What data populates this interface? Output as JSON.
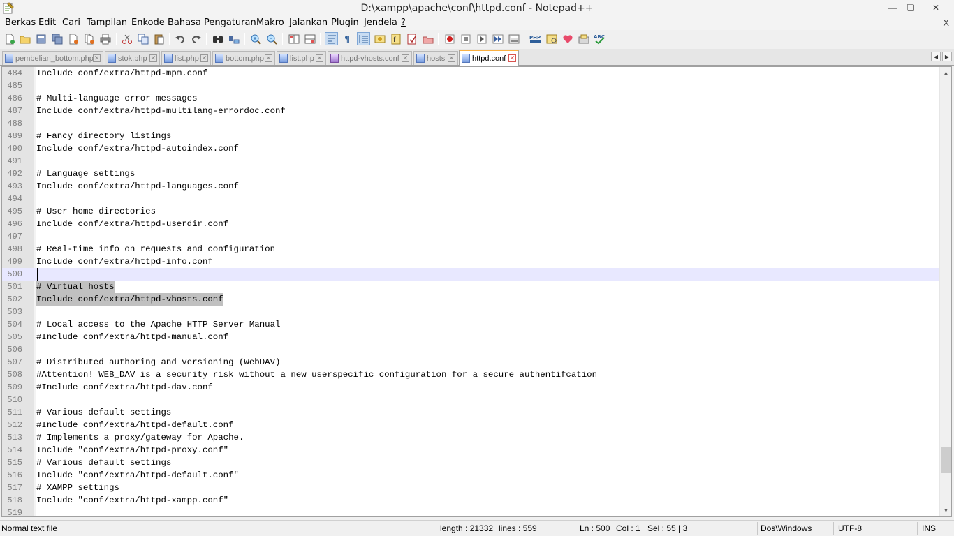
{
  "window": {
    "title": "D:\\xampp\\apache\\conf\\httpd.conf - Notepad++",
    "minimize_glyph": "—",
    "maximize_glyph": "❏",
    "close_glyph": "✕"
  },
  "menu": {
    "items": [
      "Berkas",
      "Edit",
      "Cari",
      "Tampilan",
      "Enkode",
      "Bahasa",
      "Pengaturan",
      "Makro",
      "Jalankan",
      "Plugin",
      "Jendela",
      "?"
    ],
    "close_label": "X"
  },
  "toolbar": {
    "icons": [
      "new-file-icon",
      "open-file-icon",
      "save-icon",
      "save-all-icon",
      "close-icon",
      "close-all-icon",
      "print-icon",
      "cut-icon",
      "copy-icon",
      "paste-icon",
      "undo-icon",
      "redo-icon",
      "find-icon",
      "replace-icon",
      "zoom-in-icon",
      "zoom-out-icon",
      "sync-vertical-icon",
      "sync-horizontal-icon",
      "word-wrap-icon",
      "show-all-chars-icon",
      "indent-guide-icon",
      "doc-map-icon",
      "function-list-icon",
      "folder-workspace-icon",
      "monitoring-icon",
      "record-macro-icon",
      "stop-record-icon",
      "play-macro-icon",
      "run-macro-multiple-icon",
      "save-macro-icon",
      "php-icon",
      "plugin-manager-icon",
      "heart-icon",
      "npp-export-icon",
      "spell-check-icon"
    ],
    "active": [
      "word-wrap-icon",
      "indent-guide-icon"
    ]
  },
  "tabs": [
    {
      "label": "pembelian_bottom.php",
      "active": false,
      "icon": "blue"
    },
    {
      "label": "stok.php",
      "active": false,
      "icon": "blue"
    },
    {
      "label": "list.php",
      "active": false,
      "icon": "blue"
    },
    {
      "label": "bottom.php",
      "active": false,
      "icon": "blue"
    },
    {
      "label": "list.php",
      "active": false,
      "icon": "blue"
    },
    {
      "label": "httpd-vhosts.conf",
      "active": false,
      "icon": "purple"
    },
    {
      "label": "hosts",
      "active": false,
      "icon": "blue"
    },
    {
      "label": "httpd.conf",
      "active": true,
      "icon": "blue"
    }
  ],
  "tab_close_glyph": "✕",
  "tab_nav": {
    "left": "◀",
    "right": "▶"
  },
  "editor": {
    "current_line": 500,
    "selected_lines": [
      501,
      502
    ],
    "lines": [
      {
        "n": "484",
        "text": "Include conf/extra/httpd-mpm.conf"
      },
      {
        "n": "485",
        "text": ""
      },
      {
        "n": "486",
        "text": "# Multi-language error messages"
      },
      {
        "n": "487",
        "text": "Include conf/extra/httpd-multilang-errordoc.conf"
      },
      {
        "n": "488",
        "text": ""
      },
      {
        "n": "489",
        "text": "# Fancy directory listings"
      },
      {
        "n": "490",
        "text": "Include conf/extra/httpd-autoindex.conf"
      },
      {
        "n": "491",
        "text": ""
      },
      {
        "n": "492",
        "text": "# Language settings"
      },
      {
        "n": "493",
        "text": "Include conf/extra/httpd-languages.conf"
      },
      {
        "n": "494",
        "text": ""
      },
      {
        "n": "495",
        "text": "# User home directories"
      },
      {
        "n": "496",
        "text": "Include conf/extra/httpd-userdir.conf"
      },
      {
        "n": "497",
        "text": ""
      },
      {
        "n": "498",
        "text": "# Real-time info on requests and configuration"
      },
      {
        "n": "499",
        "text": "Include conf/extra/httpd-info.conf"
      },
      {
        "n": "500",
        "text": ""
      },
      {
        "n": "501",
        "text": "# Virtual hosts"
      },
      {
        "n": "502",
        "text": "Include conf/extra/httpd-vhosts.conf"
      },
      {
        "n": "503",
        "text": ""
      },
      {
        "n": "504",
        "text": "# Local access to the Apache HTTP Server Manual"
      },
      {
        "n": "505",
        "text": "#Include conf/extra/httpd-manual.conf"
      },
      {
        "n": "506",
        "text": ""
      },
      {
        "n": "507",
        "text": "# Distributed authoring and versioning (WebDAV)"
      },
      {
        "n": "508",
        "text": "#Attention! WEB_DAV is a security risk without a new userspecific configuration for a secure authentifcation"
      },
      {
        "n": "509",
        "text": "#Include conf/extra/httpd-dav.conf"
      },
      {
        "n": "510",
        "text": ""
      },
      {
        "n": "511",
        "text": "# Various default settings"
      },
      {
        "n": "512",
        "text": "#Include conf/extra/httpd-default.conf"
      },
      {
        "n": "513",
        "text": "# Implements a proxy/gateway for Apache."
      },
      {
        "n": "514",
        "text": "Include \"conf/extra/httpd-proxy.conf\""
      },
      {
        "n": "515",
        "text": "# Various default settings"
      },
      {
        "n": "516",
        "text": "Include \"conf/extra/httpd-default.conf\""
      },
      {
        "n": "517",
        "text": "# XAMPP settings"
      },
      {
        "n": "518",
        "text": "Include \"conf/extra/httpd-xampp.conf\""
      },
      {
        "n": "519",
        "text": ""
      }
    ]
  },
  "scrollbar": {
    "up": "▲",
    "down": "▼",
    "position_fraction": 0.86
  },
  "status": {
    "file_type": "Normal text file",
    "length": "length : 21332",
    "lines": "lines : 559",
    "ln": "Ln : 500",
    "col": "Col : 1",
    "sel": "Sel : 55 | 3",
    "eol": "Dos\\Windows",
    "encoding": "UTF-8",
    "mode": "INS"
  },
  "colors": {
    "current_line": "#e8e8ff",
    "selection": "#c0c0c0",
    "active_tab_accent": "#fbb040"
  }
}
